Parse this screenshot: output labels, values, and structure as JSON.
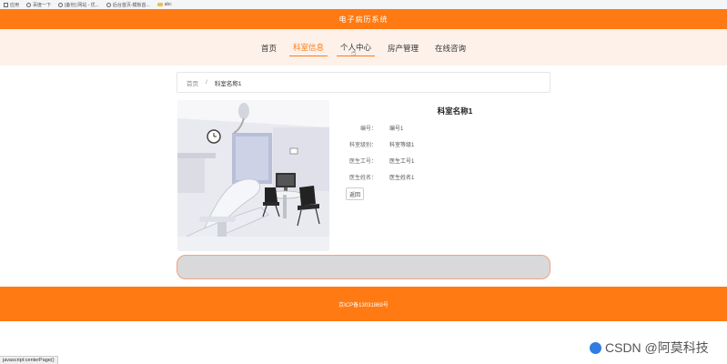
{
  "browser": {
    "bookmarks": [
      {
        "label": "应用",
        "icon": "apps-grid-icon"
      },
      {
        "label": "百度一下",
        "icon": "globe-icon"
      },
      {
        "label": "[备份] 网站 - 优...",
        "icon": "globe-icon"
      },
      {
        "label": "后台首页-模板首...",
        "icon": "page-icon"
      },
      {
        "label": "abc",
        "icon": "folder-icon"
      }
    ],
    "status_url": "javascript:centerPage()"
  },
  "header": {
    "title": "电子病历系统"
  },
  "nav": {
    "items": [
      {
        "label": "首页"
      },
      {
        "label": "科室信息"
      },
      {
        "label": "个人中心"
      },
      {
        "label": "房产管理"
      },
      {
        "label": "在线咨询"
      }
    ]
  },
  "breadcrumb": {
    "home": "首页",
    "separator": "/",
    "current": "科室名称1"
  },
  "detail": {
    "title": "科室名称1",
    "fields": [
      {
        "label": "编号：",
        "value": "编号1"
      },
      {
        "label": "科室级别：",
        "value": "科室等级1"
      },
      {
        "label": "医生工号：",
        "value": "医生工号1"
      },
      {
        "label": "医生姓名：",
        "value": "医生姓名1"
      }
    ],
    "back_label": "返回"
  },
  "footer": {
    "text": "京ICP备13031869号"
  },
  "watermark": {
    "text": "CSDN @阿莫科技"
  },
  "colors": {
    "brand": "#ff7a12",
    "nav_bg": "#fdf1ea",
    "bar_grey": "#d9d9db"
  }
}
